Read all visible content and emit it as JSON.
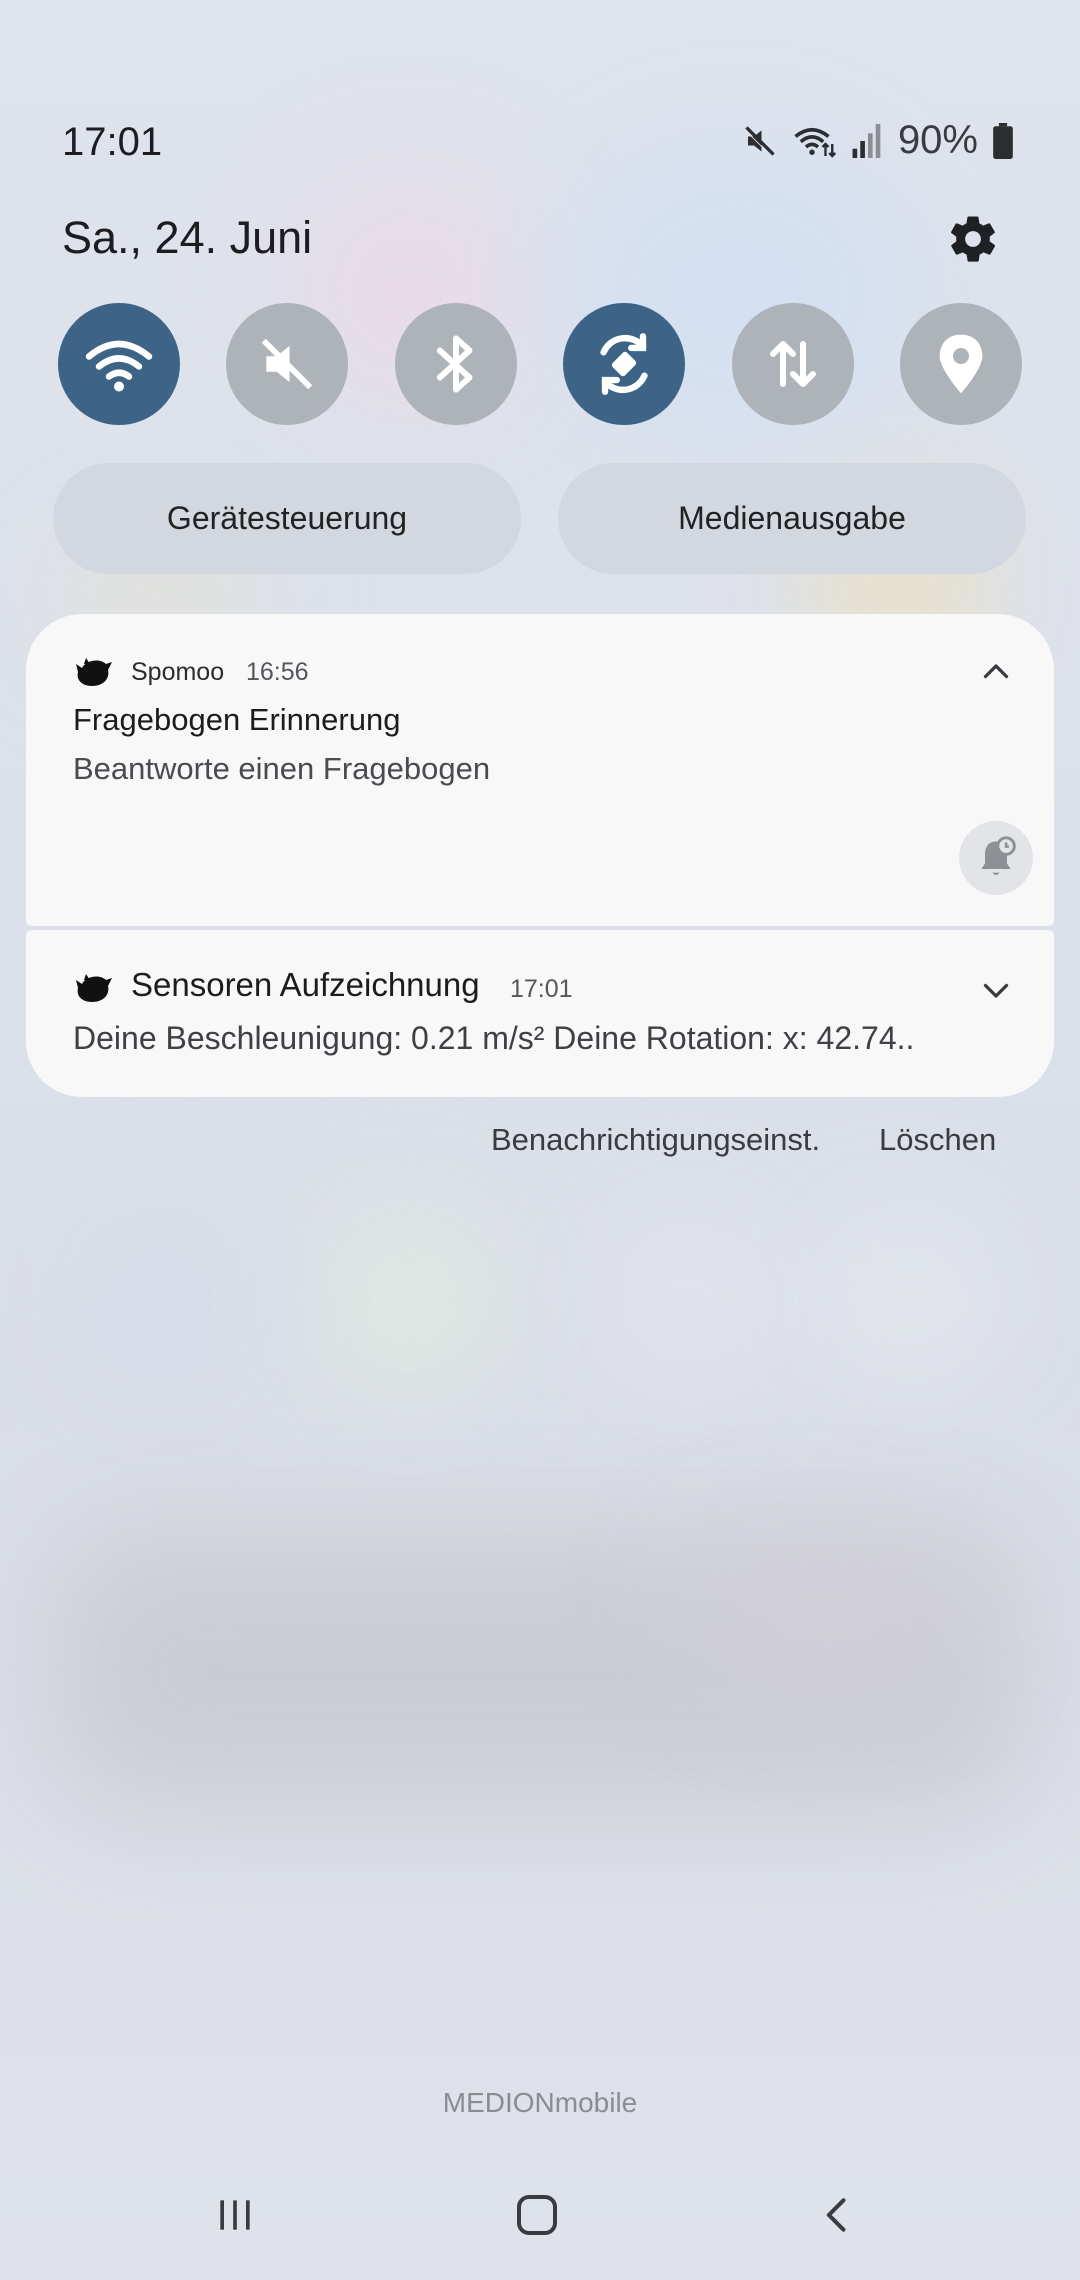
{
  "status_bar": {
    "time": "17:01",
    "battery_percent": "90%",
    "icons": [
      "mute-icon",
      "wifi-icon",
      "signal-icon",
      "battery-icon"
    ]
  },
  "header": {
    "date": "Sa., 24. Juni",
    "settings_icon": "gear-icon"
  },
  "quick_settings": {
    "tiles": [
      {
        "name": "wifi",
        "icon": "wifi-icon",
        "state": "on"
      },
      {
        "name": "sound",
        "icon": "mute-icon",
        "state": "off"
      },
      {
        "name": "bluetooth",
        "icon": "bluetooth-icon",
        "state": "off"
      },
      {
        "name": "auto-rotate",
        "icon": "rotate-icon",
        "state": "on"
      },
      {
        "name": "mobile-data",
        "icon": "data-arrows-icon",
        "state": "off"
      },
      {
        "name": "location",
        "icon": "location-pin-icon",
        "state": "off"
      }
    ],
    "device_control_label": "Gerätesteuerung",
    "media_output_label": "Medienausgabe"
  },
  "notifications": [
    {
      "app": "Spomoo",
      "time": "16:56",
      "title": "Fragebogen Erinnerung",
      "body": "Beantworte einen Fragebogen",
      "expanded": true
    },
    {
      "app": "",
      "time": "17:01",
      "title": "Sensoren Aufzeichnung",
      "body": "Deine Beschleunigung: 0.21 m/s² Deine Rotation: x: 42.74..",
      "expanded": false
    }
  ],
  "actions": {
    "notification_settings": "Benachrichtigungseinst.",
    "clear": "Löschen"
  },
  "carrier": "MEDIONmobile",
  "colors": {
    "tile_on": "#3d6386",
    "tile_off": "#aeb2b9",
    "card_bg": "#f8f8f9",
    "panel_bg": "#dde1ea"
  }
}
